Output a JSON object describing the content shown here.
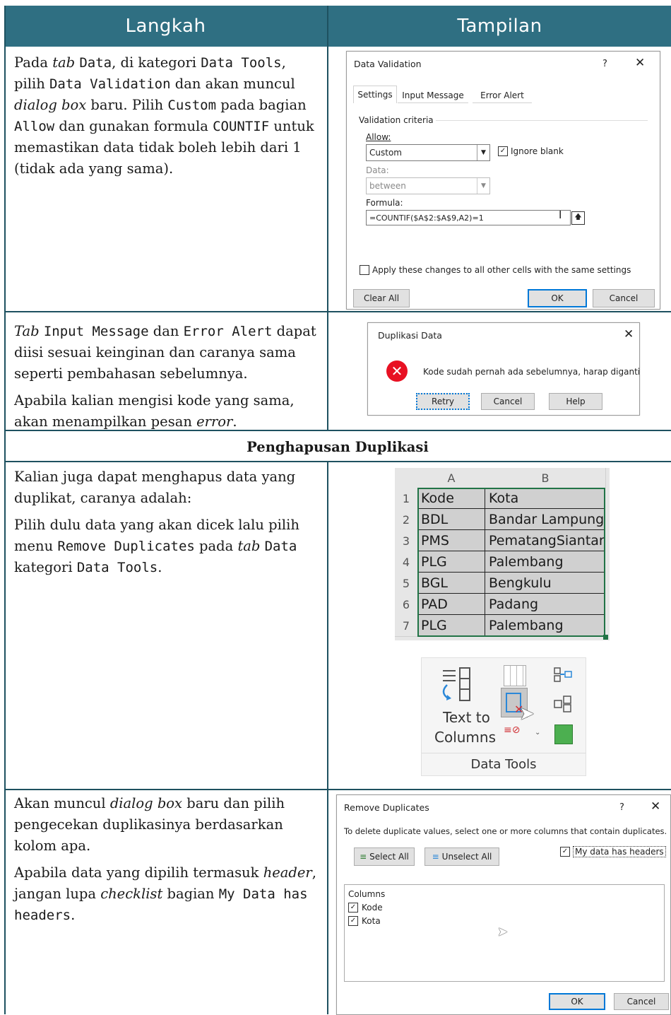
{
  "header": {
    "col1": "Langkah",
    "col2": "Tampilan"
  },
  "row1": {
    "text": {
      "p1_a": "Pada ",
      "p1_tab": "tab",
      "p1_b": " ",
      "p1_data": "Data",
      "p1_c": ", di kategori ",
      "p1_tools": "Data Tools",
      "p1_d": ", pilih ",
      "p1_dv": "Data Validation",
      "p1_e": " dan akan muncul ",
      "p1_dialog": "dialog box",
      "p1_f": " baru. Pilih ",
      "p1_custom": "Custom",
      "p1_g": " pada bagian ",
      "p1_allow": "Allow",
      "p1_h": " dan gunakan formula ",
      "p1_countif": "COUNTIF",
      "p1_i": " untuk memastikan data tidak boleh lebih dari 1 (tidak ada yang sama)."
    },
    "dialog": {
      "title": "Data Validation",
      "help": "?",
      "close": "✕",
      "tabs": [
        "Settings",
        "Input Message",
        "Error Alert"
      ],
      "criteria_label": "Validation criteria",
      "allow_label": "Allow:",
      "allow_value": "Custom",
      "ignore_blank": "Ignore blank",
      "data_label": "Data:",
      "data_value": "between",
      "formula_label": "Formula:",
      "formula_value": "=COUNTIF($A$2:$A$9,A2)=1",
      "apply_all": "Apply these changes to all other cells with the same settings",
      "clear_all": "Clear All",
      "ok": "OK",
      "cancel": "Cancel"
    }
  },
  "row2": {
    "text": {
      "p1_tab": "Tab",
      "p1_im": "Input Message",
      "p1_a": " dan ",
      "p1_ea": "Error Alert",
      "p1_b": " dapat diisi sesuai keinginan dan caranya sama seperti pembahasan sebelumnya.",
      "p2_a": "Apabila kalian mengisi kode yang sama, akan menampilkan pesan ",
      "p2_error": "error",
      "p2_b": "."
    },
    "dialog": {
      "title": "Duplikasi Data",
      "close": "✕",
      "message": "Kode sudah pernah ada sebelumnya, harap diganti",
      "retry": "Retry",
      "cancel": "Cancel",
      "help": "Help"
    }
  },
  "section_title": "Penghapusan Duplikasi",
  "row3": {
    "text": {
      "p1": "Kalian juga dapat menghapus data yang duplikat, caranya adalah:",
      "p2_a": "Pilih dulu data yang akan dicek lalu pilih menu ",
      "p2_rd": "Remove Duplicates",
      "p2_b": " pada ",
      "p2_tab": "tab",
      "p2_c": " ",
      "p2_data": "Data",
      "p2_d": " kategori ",
      "p2_tools": "Data Tools",
      "p2_e": "."
    },
    "sheet": {
      "col_a": "A",
      "col_b": "B",
      "rows": [
        {
          "n": "1",
          "a": "Kode",
          "b": "Kota"
        },
        {
          "n": "2",
          "a": "BDL",
          "b": "Bandar Lampung"
        },
        {
          "n": "3",
          "a": "PMS",
          "b": "PematangSiantar"
        },
        {
          "n": "4",
          "a": "PLG",
          "b": "Palembang"
        },
        {
          "n": "5",
          "a": "BGL",
          "b": "Bengkulu"
        },
        {
          "n": "6",
          "a": "PAD",
          "b": "Padang"
        },
        {
          "n": "7",
          "a": "PLG",
          "b": "Palembang"
        }
      ]
    },
    "ribbon": {
      "text_to": "Text to",
      "columns": "Columns",
      "group": "Data Tools"
    }
  },
  "row4": {
    "text": {
      "p1_a": "Akan muncul ",
      "p1_dialog": "dialog box",
      "p1_b": " baru dan pilih pengecekan duplikasinya berdasarkan kolom apa.",
      "p2_a": "Apabila data yang dipilih termasuk ",
      "p2_header": "header",
      "p2_b": ",  jangan lupa ",
      "p2_check": "checklist",
      "p2_c": " bagian ",
      "p2_my": "My Data has headers",
      "p2_d": "."
    },
    "dialog": {
      "title": "Remove Duplicates",
      "help": "?",
      "close": "✕",
      "instruction": "To delete duplicate values, select one or more columns that contain duplicates.",
      "select_all": "Select All",
      "unselect_all": "Unselect All",
      "my_headers": "My data has headers",
      "columns_label": "Columns",
      "col1": "Kode",
      "col2": "Kota",
      "ok": "OK",
      "cancel": "Cancel"
    }
  },
  "colors": {
    "header": "#2f6f82",
    "border": "#1e5160",
    "cell": "#d0d0d0",
    "focus": "#0078d7"
  }
}
